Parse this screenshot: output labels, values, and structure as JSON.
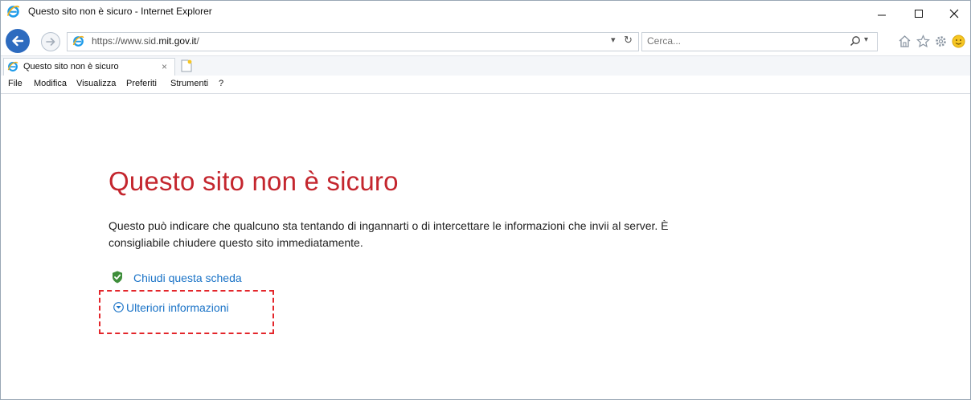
{
  "window": {
    "title": "Questo sito non è sicuro - Internet Explorer"
  },
  "address": {
    "url_prefix": "https://www.sid.",
    "url_domain": "mit.gov.it",
    "url_suffix": "/"
  },
  "search": {
    "placeholder": "Cerca..."
  },
  "tab": {
    "label": "Questo sito non è sicuro",
    "close_glyph": "×"
  },
  "menu": {
    "items": [
      "File",
      "Modifica",
      "Visualizza",
      "Preferiti",
      "Strumenti",
      "?"
    ]
  },
  "page": {
    "heading": "Questo sito non è sicuro",
    "description": "Questo può indicare che qualcuno sta tentando di ingannarti o di intercettare le informazioni che invii al server. È consigliabile chiudere questo sito immediatamente.",
    "close_link": "Chiudi questa scheda",
    "more_link": "Ulteriori informazioni"
  },
  "colors": {
    "heading_red": "#c4262e",
    "link_blue": "#1a73c7",
    "annotation_red": "#e3262b",
    "ie_blue": "#2d6bbf"
  },
  "icons": [
    "ie-logo-icon",
    "back-arrow-icon",
    "forward-arrow-icon",
    "refresh-icon",
    "search-icon",
    "home-icon",
    "favorites-star-icon",
    "settings-gear-icon",
    "smiley-feedback-icon",
    "new-tab-icon",
    "shield-check-icon",
    "chevron-down-circle-icon"
  ]
}
